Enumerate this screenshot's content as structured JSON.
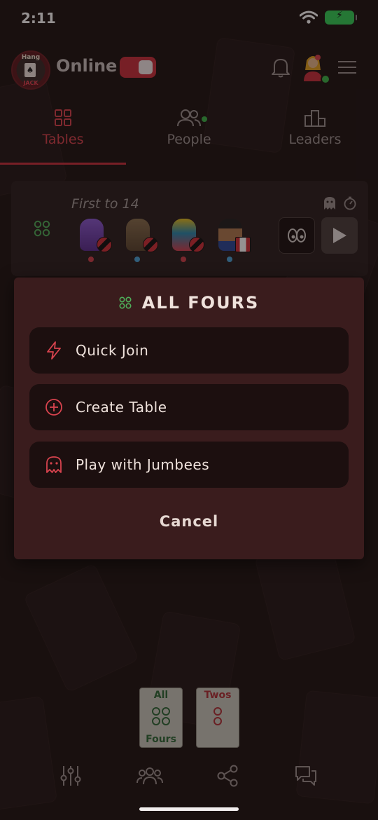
{
  "status_bar": {
    "time": "2:11"
  },
  "header": {
    "logo_text_top": "Hang",
    "logo_text_bottom": "JACK",
    "online_label": "Online",
    "online_toggle_on": true
  },
  "tabs": [
    {
      "label": "Tables",
      "active": true
    },
    {
      "label": "People",
      "active": false,
      "has_online_indicator": true
    },
    {
      "label": "Leaders",
      "active": false
    }
  ],
  "table_card": {
    "title": "First to 14",
    "players": [
      {
        "avatar": "purple-monster",
        "flag": "trinidad-and-tobago",
        "status_color": "#d0404c"
      },
      {
        "avatar": "owl",
        "flag": "trinidad-and-tobago",
        "status_color": "#4aa3d8"
      },
      {
        "avatar": "parrot",
        "flag": "trinidad-and-tobago",
        "status_color": "#d0404c"
      },
      {
        "avatar": "girl",
        "flag": "canada",
        "status_color": "#4aa3d8"
      }
    ]
  },
  "sheet": {
    "title": "ALL FOURS",
    "options": [
      {
        "label": "Quick Join",
        "icon": "lightning-icon"
      },
      {
        "label": "Create Table",
        "icon": "plus-circle-icon"
      },
      {
        "label": "Play with Jumbees",
        "icon": "ghost-icon"
      }
    ],
    "cancel_label": "Cancel"
  },
  "game_chips": [
    {
      "top": "All",
      "bottom": "Fours",
      "top_color": "#2f6b3a"
    },
    {
      "top": "Twos",
      "bottom": "",
      "top_color": "#b0323a"
    }
  ],
  "colors": {
    "accent": "#c8303c",
    "online_green": "#3bb54a",
    "mode_green": "#4fae5a",
    "background": "#1e1413",
    "sheet": "#3a1c1d"
  }
}
